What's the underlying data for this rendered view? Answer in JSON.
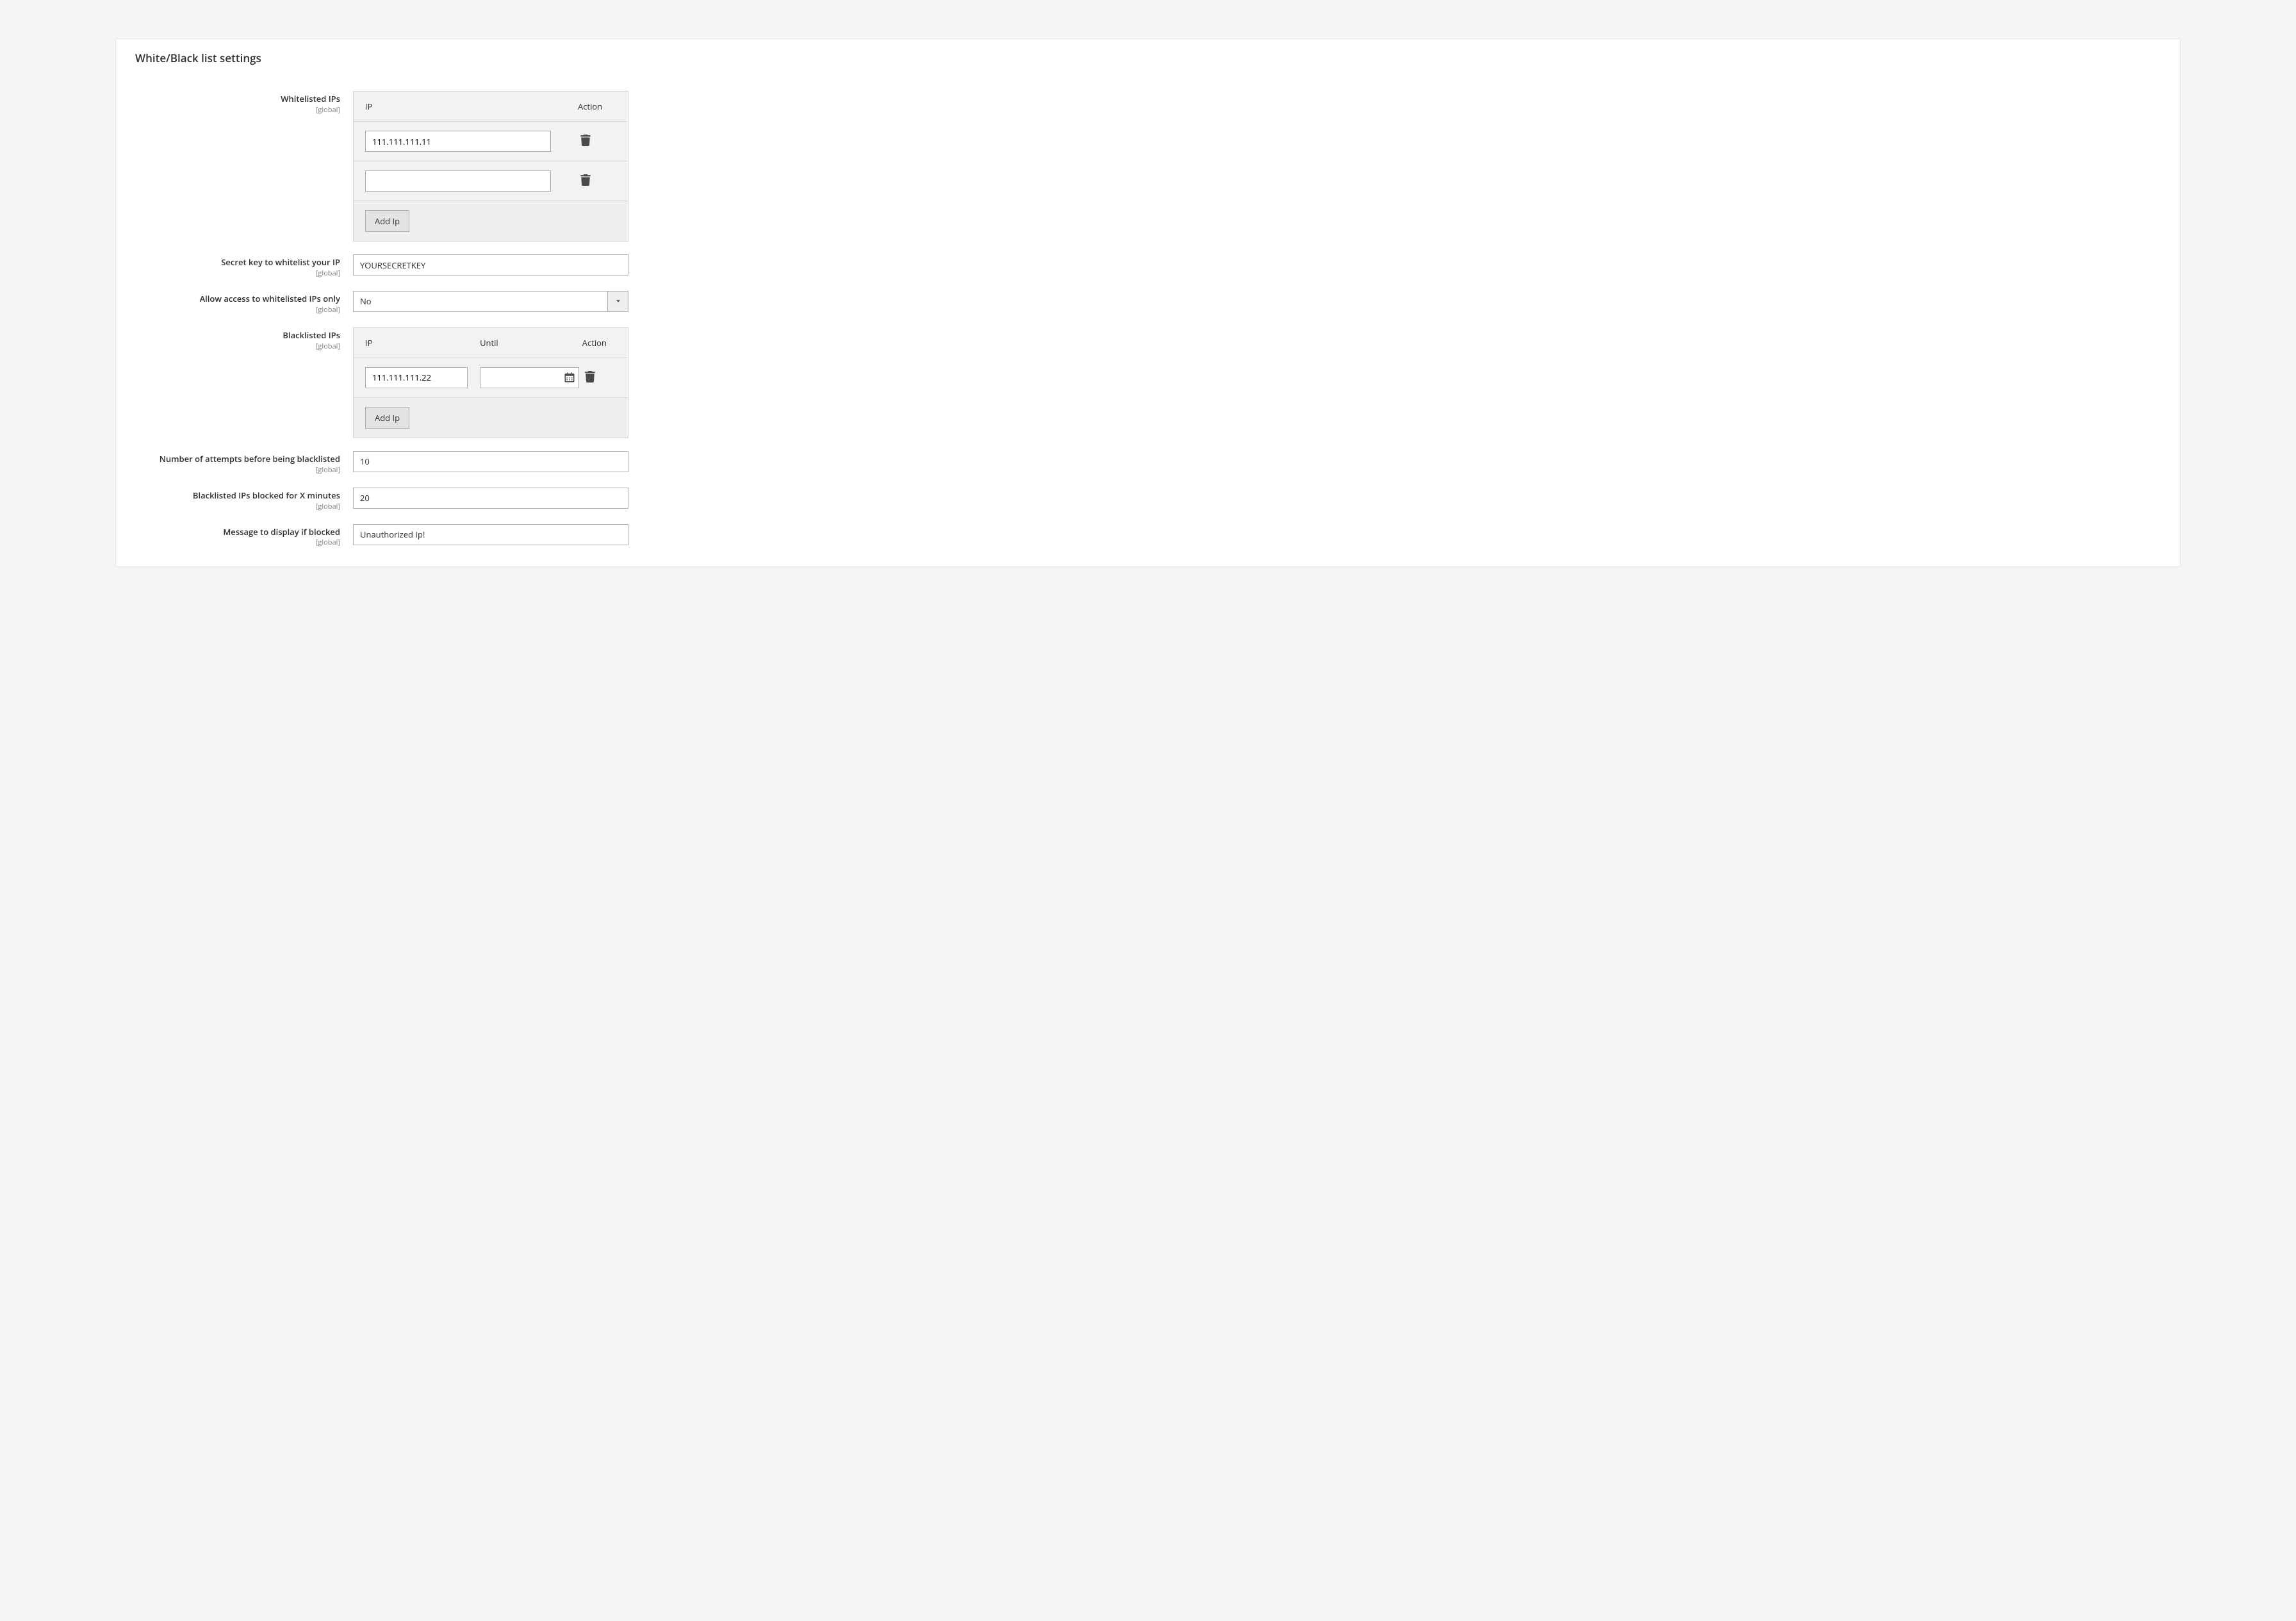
{
  "panel": {
    "title": "White/Black list settings"
  },
  "scopeLabel": "[global]",
  "whitelist": {
    "label": "Whitelisted IPs",
    "headers": {
      "ip": "IP",
      "action": "Action"
    },
    "rows": [
      {
        "ip": "111.111.111.11"
      },
      {
        "ip": ""
      }
    ],
    "addBtn": "Add Ip"
  },
  "secretKey": {
    "label": "Secret key to whitelist your IP",
    "value": "YOURSECRETKEY"
  },
  "allowWhitelistedOnly": {
    "label": "Allow access to whitelisted IPs only",
    "value": "No"
  },
  "blacklist": {
    "label": "Blacklisted IPs",
    "headers": {
      "ip": "IP",
      "until": "Until",
      "action": "Action"
    },
    "rows": [
      {
        "ip": "111.111.111.22",
        "until": ""
      }
    ],
    "addBtn": "Add Ip"
  },
  "attempts": {
    "label": "Number of attempts before being blacklisted",
    "value": "10"
  },
  "blockedMinutes": {
    "label": "Blacklisted IPs blocked for X minutes",
    "value": "20"
  },
  "blockedMessage": {
    "label": "Message to display if blocked",
    "value": "Unauthorized Ip!"
  }
}
